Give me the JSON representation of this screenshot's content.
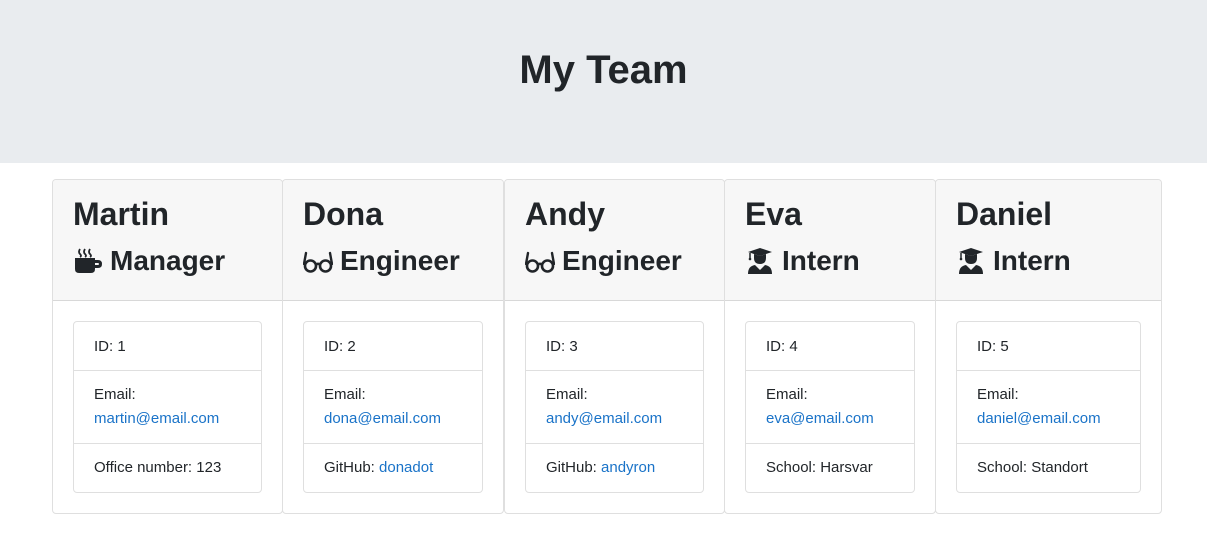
{
  "page": {
    "title": "My Team"
  },
  "team": [
    {
      "name": "Martin",
      "role": "Manager",
      "icon": "coffee-icon",
      "id_text": "ID: 1",
      "email_label": "Email:",
      "email": "martin@email.com",
      "extra_label": "Office number: 123",
      "extra_link": ""
    },
    {
      "name": "Dona",
      "role": "Engineer",
      "icon": "glasses-icon",
      "id_text": "ID: 2",
      "email_label": "Email:",
      "email": "dona@email.com",
      "extra_label": "GitHub: ",
      "extra_link": "donadot"
    },
    {
      "name": "Andy",
      "role": "Engineer",
      "icon": "glasses-icon",
      "id_text": "ID: 3",
      "email_label": "Email:",
      "email": "andy@email.com",
      "extra_label": "GitHub: ",
      "extra_link": "andyron"
    },
    {
      "name": "Eva",
      "role": "Intern",
      "icon": "graduate-icon",
      "id_text": "ID: 4",
      "email_label": "Email:",
      "email": "eva@email.com",
      "extra_label": "School: Harsvar",
      "extra_link": ""
    },
    {
      "name": "Daniel",
      "role": "Intern",
      "icon": "graduate-icon",
      "id_text": "ID: 5",
      "email_label": "Email:",
      "email": "daniel@email.com",
      "extra_label": "School: Standort",
      "extra_link": ""
    }
  ],
  "colors": {
    "link": "#1a73c8",
    "header_bg": "#e9ecef",
    "card_header_bg": "#f7f7f7"
  }
}
